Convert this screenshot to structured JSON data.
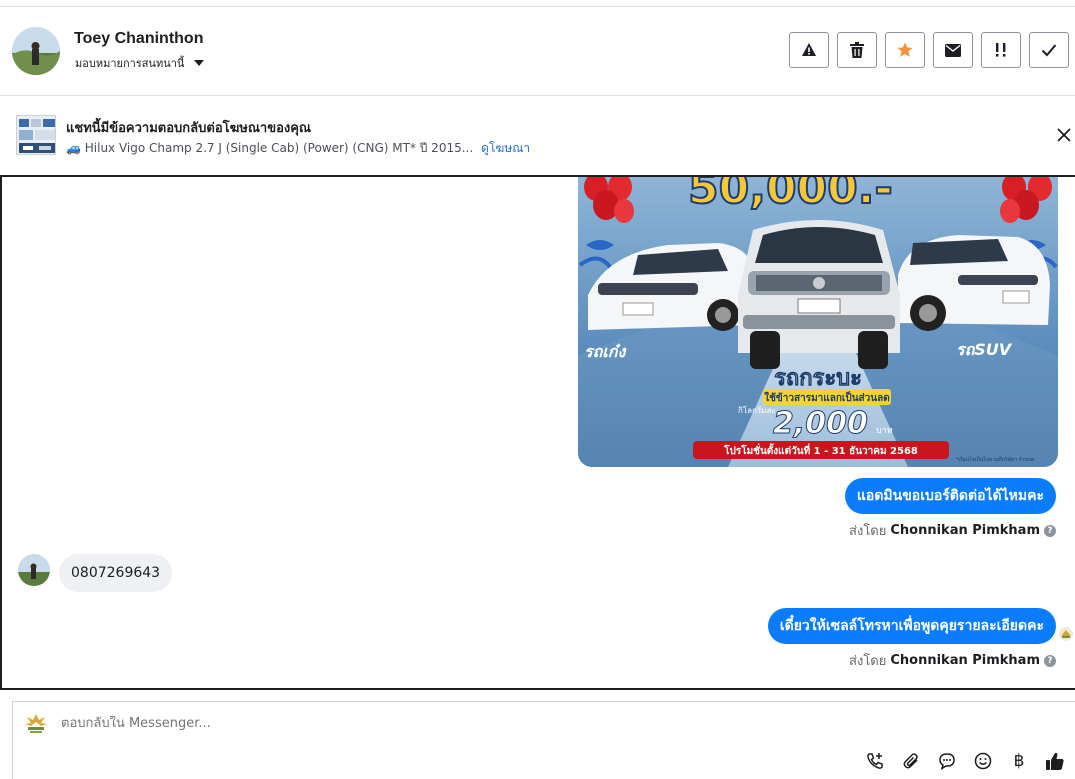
{
  "header": {
    "contact_name": "Toey Chaninthon",
    "assign_label": "มอบหมายการสนทนานี้",
    "actions": [
      {
        "name": "report-button",
        "icon": "warning-icon"
      },
      {
        "name": "delete-button",
        "icon": "trash-icon"
      },
      {
        "name": "star-button",
        "icon": "star-icon",
        "color": "#f7923b"
      },
      {
        "name": "mark-unread-button",
        "icon": "envelope-icon"
      },
      {
        "name": "follow-up-button",
        "icon": "double-exclaim-icon"
      },
      {
        "name": "mark-done-button",
        "icon": "check-icon"
      }
    ]
  },
  "ad_banner": {
    "title": "แชทนี้มีข้อความตอบกลับต่อโฆษณาของคุณ",
    "ad_name": "🚙 Hilux Vigo Champ 2.7 J (Single Cab) (Power) (CNG) MT* ปี 2015...",
    "view_ad_link": "ดูโฆษณา"
  },
  "chat": {
    "ad_image": {
      "headline_partial": "50,000.-",
      "left_label": "รถเก๋ง",
      "right_label": "รถSUV",
      "center_label": "รถกระบะ",
      "trade_label": "ใช้ข้าวสารมาแลกเป็นส่วนลด",
      "kilo_label": "กิโลกรัมละ",
      "price": "2,000",
      "price_unit": "บาท",
      "promo_period": "โปรโมชั่นตั้งแต่วันที่ 1 - 31 ธันวาคม 2568",
      "footnote": "*เงื่อนไขเป็นไปตามที่บริษัทฯ กำหนด"
    },
    "messages": [
      {
        "direction": "out",
        "text": "แอดมินขอเบอร์ติดต่อได้ไหมคะ",
        "sent_by_label": "ส่งโดย",
        "sender": "Chonnikan Pimkham"
      },
      {
        "direction": "in",
        "text": "0807269643"
      },
      {
        "direction": "out",
        "text": "เดี๋ยวให้เซลล์โทรหาเพื่อพูดคุยรายละเอียดคะ",
        "sent_by_label": "ส่งโดย",
        "sender": "Chonnikan Pimkham"
      }
    ]
  },
  "composer": {
    "placeholder": "ตอบกลับใน Messenger...",
    "tools": [
      "call-add-icon",
      "attachment-icon",
      "saved-replies-icon",
      "emoji-icon",
      "baht-icon",
      "like-icon"
    ],
    "baht_symbol": "฿"
  },
  "colors": {
    "accent": "#0a7cff",
    "link": "#216fdb",
    "star": "#f7923b"
  }
}
